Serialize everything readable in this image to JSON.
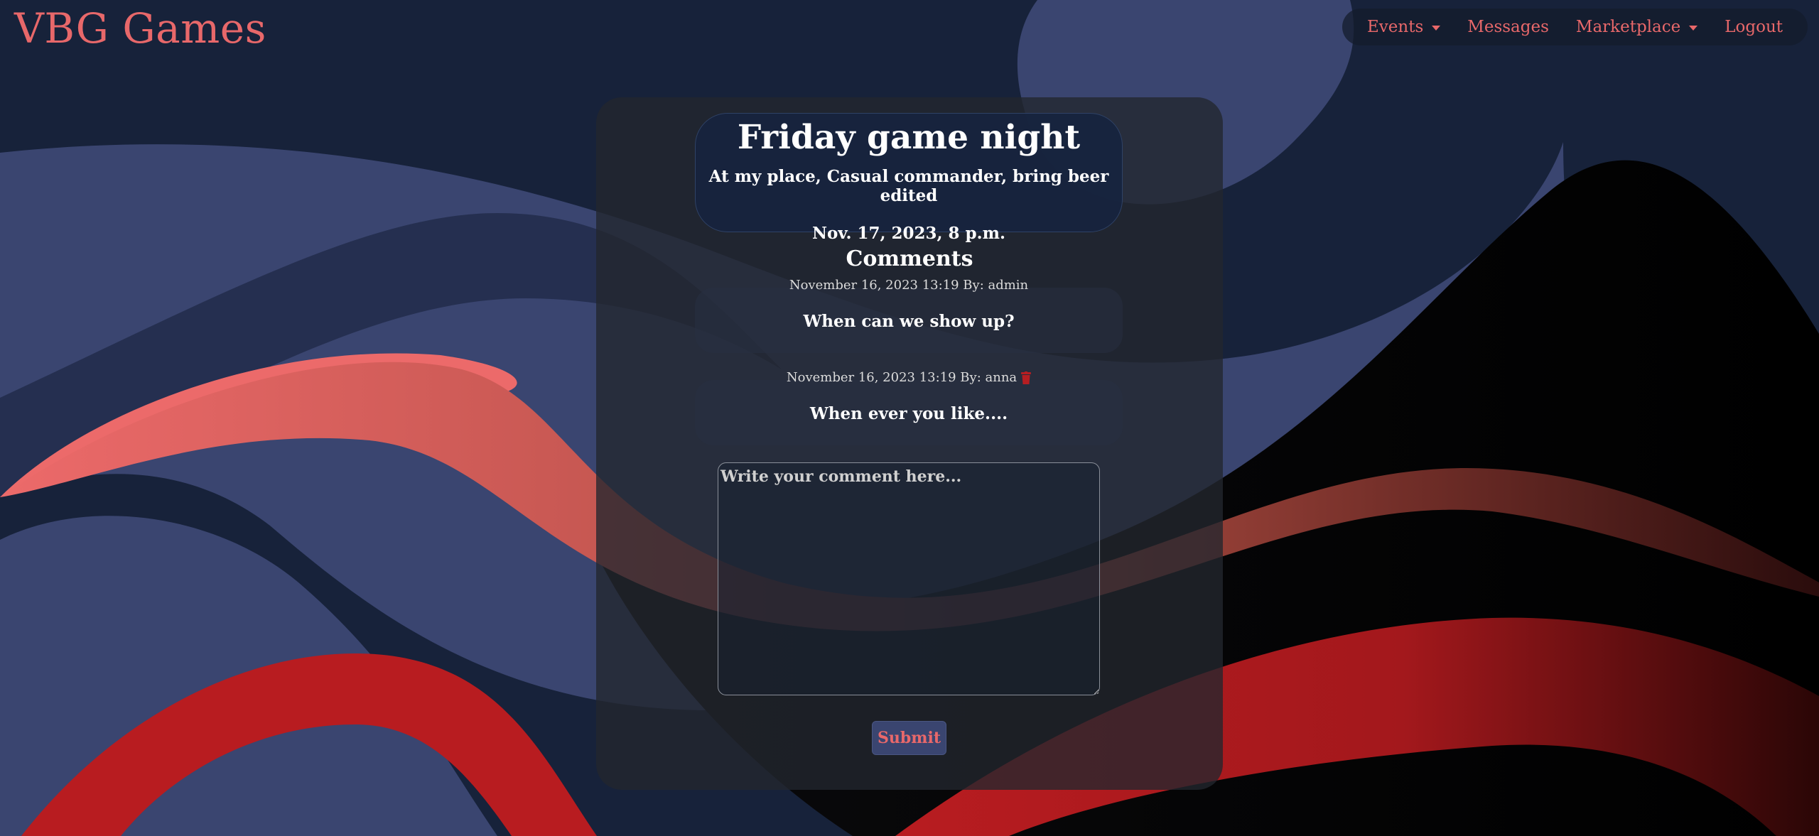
{
  "brand": {
    "title": "VBG Games"
  },
  "nav": {
    "items": [
      {
        "label": "Events",
        "dropdown": true
      },
      {
        "label": "Messages",
        "dropdown": false
      },
      {
        "label": "Marketplace",
        "dropdown": true
      },
      {
        "label": "Logout",
        "dropdown": false
      }
    ]
  },
  "event": {
    "title": "Friday game night",
    "description": "At my place, Casual commander, bring beer edited",
    "date": "Nov. 17, 2023, 8 p.m."
  },
  "comments": {
    "heading": "Comments",
    "items": [
      {
        "meta": "November 16, 2023 13:19 By: admin",
        "body": "When can we show up?",
        "can_delete": false
      },
      {
        "meta": "November 16, 2023 13:19 By: anna",
        "body": "When ever you like....",
        "can_delete": true
      }
    ]
  },
  "form": {
    "placeholder": "Write your comment here...",
    "value": "",
    "submit_label": "Submit"
  },
  "colors": {
    "brand_accent": "#e8686a",
    "background": "#17223a",
    "wave_slate": "#3a4570",
    "wave_coral": "#ec6a6a",
    "wave_red": "#b81c20",
    "delete_icon": "#b51e22"
  },
  "icons": {
    "dropdown": "caret-down-icon",
    "delete": "trash-icon"
  }
}
